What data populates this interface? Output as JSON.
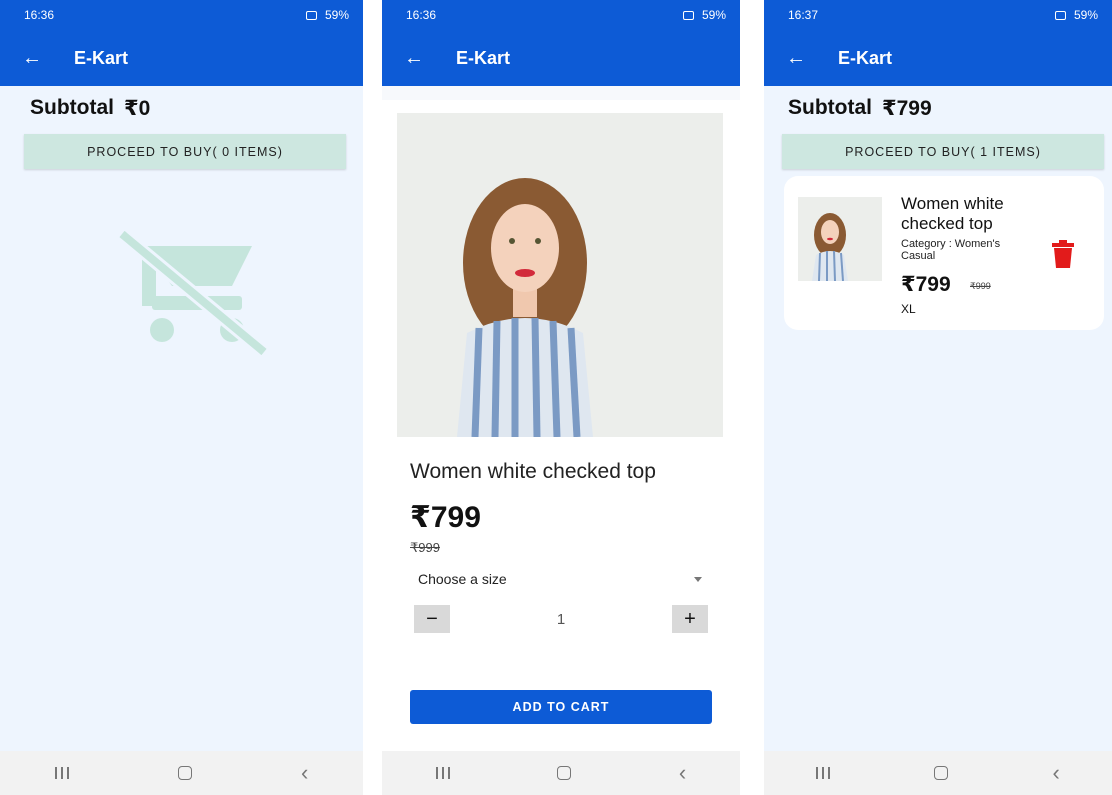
{
  "colors": {
    "primary": "#0d5bd6",
    "accent_button": "#cde7e0",
    "delete": "#e21b1b",
    "background": "#eef5fe"
  },
  "screens": [
    {
      "status": {
        "time": "16:36",
        "battery": "59%"
      },
      "appbar": {
        "back_icon": "arrow-left-icon",
        "title": "E-Kart"
      },
      "subtotal_label": "Subtotal",
      "subtotal_value": "₹0",
      "proceed_label": "PROCEED TO BUY( 0 ITEMS)",
      "empty_icon": "remove-shopping-cart-icon"
    },
    {
      "status": {
        "time": "16:36",
        "battery": "59%"
      },
      "appbar": {
        "back_icon": "arrow-left-icon",
        "title": "E-Kart"
      },
      "product": {
        "title": "Women white checked top",
        "price": "₹799",
        "old_price": "₹999",
        "size_placeholder": "Choose a size",
        "quantity": "1",
        "minus": "−",
        "plus": "+",
        "add_to_cart": "ADD TO CART"
      }
    },
    {
      "status": {
        "time": "16:37",
        "battery": "59%"
      },
      "appbar": {
        "back_icon": "arrow-left-icon",
        "title": "E-Kart"
      },
      "subtotal_label": "Subtotal",
      "subtotal_value": "₹799",
      "proceed_label": "PROCEED TO BUY( 1 ITEMS)",
      "cart_item": {
        "title": "Women white checked top",
        "category": "Category : Women's Casual",
        "price": "₹799",
        "old_price": "₹999",
        "size": "XL",
        "delete_icon": "trash-icon"
      }
    }
  ],
  "navbar": {
    "recent_icon": "recent-apps-icon",
    "home_icon": "home-icon",
    "back_icon": "back-icon"
  }
}
